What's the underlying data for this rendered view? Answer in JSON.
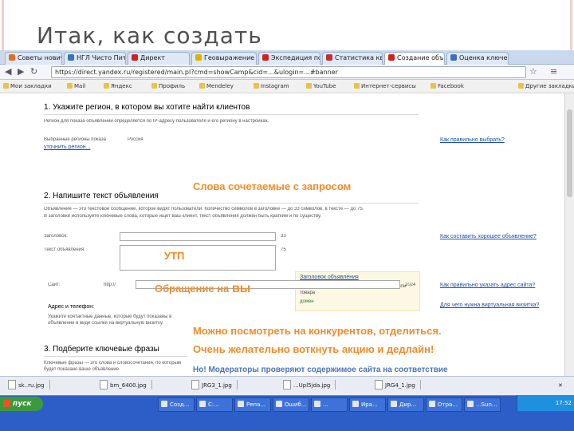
{
  "slide": {
    "title": "Итак, как создать"
  },
  "browser": {
    "tabs": [
      {
        "label": "Советы новичк",
        "color": "#e07020"
      },
      {
        "label": "НГЛ Чисто Пит",
        "color": "#3a70c0"
      },
      {
        "label": "Директ",
        "color": "#d02020"
      },
      {
        "label": "Геовыражение",
        "color": "#e0b000"
      },
      {
        "label": "Экспедиция по гр",
        "color": "#d02020"
      },
      {
        "label": "Статистика квес",
        "color": "#c03030"
      },
      {
        "label": "Создание объявл",
        "color": "#d02020"
      },
      {
        "label": "Оценка ключевых",
        "color": "#3a70c0"
      }
    ],
    "url": "https://direct.yandex.ru/registered/main.pl?cmd=showCamp&cid=...&ulogin=...#banner",
    "bookmarks": [
      "Мои закладки",
      "Mail",
      "Яндекс",
      "Профиль",
      "Mendeley",
      "Instagram",
      "YouTube",
      "Интернет-сервисы",
      "Facebook",
      "Другие закладки"
    ]
  },
  "form": {
    "section1_title": "1. Укажите регион, в котором вы хотите найти клиентов",
    "section1_desc": "Регион для показа объявлений определяется по IP-адресу пользователя и его региону в настройках.",
    "region_label": "Выбранные регионы показа",
    "region_value": "Россия",
    "region_link": "уточнить регион...",
    "help_link1": "Как правильно выбрать?",
    "section2_title": "2. Напишите текст объявления",
    "section2_desc1": "Объявление — это текстовое сообщение, которое видят пользователи. Количество символов в заголовке — до 33 символов, в тексте — до 75.",
    "section2_desc2": "В заголовке используйте ключевые слова, которые ищет ваш клиент, текст объявления должен быть кратким и по существу.",
    "headline_label": "Заголовок:",
    "text_label": "Текст объявления:",
    "counter1": "33",
    "counter2": "75",
    "ad_preview_title": "Заголовок объявления",
    "ad_preview_text": "Текст вашего объявления в рекламе услуги или товара",
    "ad_preview_domain": "домен",
    "help_link2": "Как составить хорошее объявление?",
    "site_label": "Сайт:",
    "site_prefix": "http://",
    "counter3": "1024",
    "help_link3": "Как правильно указать адрес сайта?",
    "address_label": "Адрес и телефон:",
    "address_desc": "Укажите контактные данные, которые будут показаны в объявлении в виде ссылки на виртуальную визитку.",
    "help_link4": "Для чего нужна виртуальная визитка?",
    "section3_title": "3. Подберите ключевые фразы",
    "section3_desc": "Ключевые фразы — это слова и словосочетания, по которым будет показано ваше объявление."
  },
  "annotations": {
    "keywords_note": "Слова сочетаемые с запросом",
    "usp_note": "УТП",
    "address_note_prefix": "Обращение на ",
    "address_note_emph": "вы",
    "competitors_note": "Можно посмотреть на конкурентов, отделиться.",
    "promo_note": "Очень желательно воткнуть акцию и дедлайн!",
    "moderators_note": "Но! Модераторы проверяют содержимое сайта на соответствие"
  },
  "downloads": [
    "sk..ru.jpg",
    "bm_6400.jpg",
    "JRG3_1.jpg",
    "...Upl5jda.jpg",
    "JRG4_1.jpg"
  ],
  "taskbar": {
    "start_label": "пуск",
    "items": [
      "Созд...",
      "С:...",
      "Репа...",
      "Ошиб...",
      "...",
      "Ира...",
      "Дир...",
      "Отра...",
      "...Sun..."
    ],
    "clock": "17:52"
  },
  "colors": {
    "note_orange": "#f28c28",
    "note_blue": "#4a74b5",
    "link_blue": "#1a4ea8",
    "taskbar_blue": "#2d5ec8",
    "start_green": "#3c9a3c"
  }
}
